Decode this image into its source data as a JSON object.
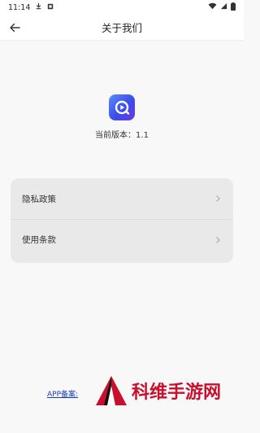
{
  "status_bar": {
    "time": "11:14"
  },
  "header": {
    "title": "关于我们"
  },
  "about": {
    "version_label": "当前版本：",
    "version_value": "1.1"
  },
  "menu": {
    "items": [
      {
        "label": "隐私政策"
      },
      {
        "label": "使用条款"
      }
    ]
  },
  "footer": {
    "icp_link": "APP备案:"
  },
  "watermark": {
    "text": "科维手游网"
  },
  "colors": {
    "accent": "#3a4de8",
    "watermark": "#c8102e",
    "card": "#e9e9e9"
  }
}
